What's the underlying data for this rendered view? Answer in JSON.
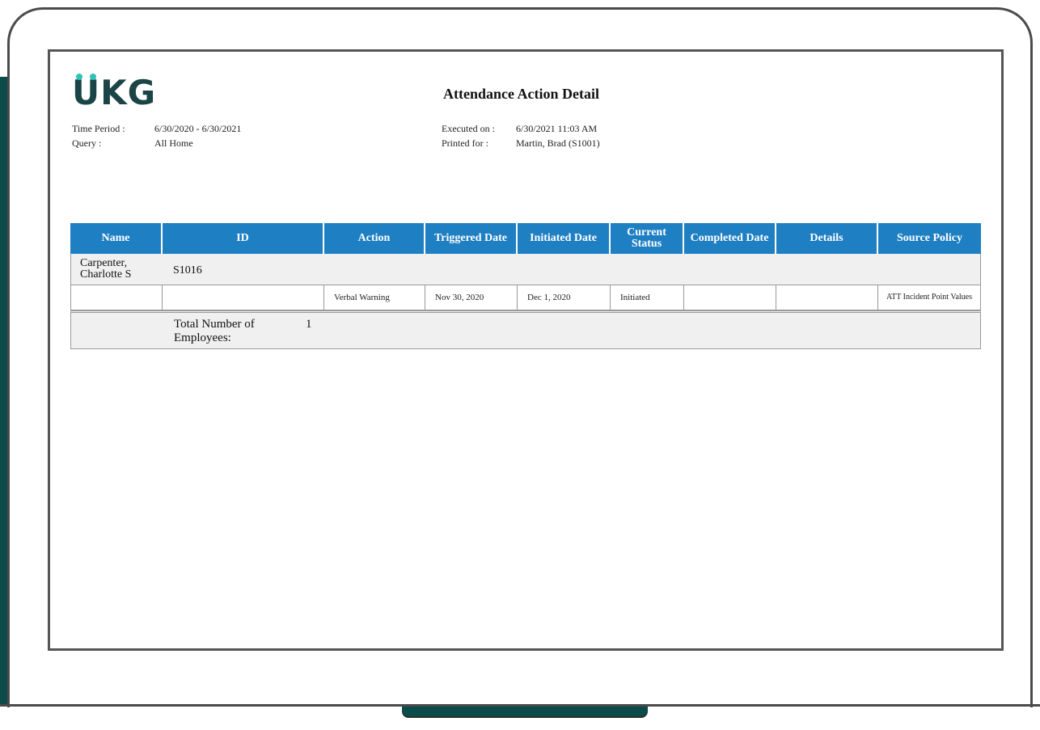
{
  "report": {
    "logo_text": "UKG",
    "title": "Attendance Action Detail",
    "time_period_label": "Time Period :",
    "time_period_value": "6/30/2020 - 6/30/2021",
    "query_label": "Query :",
    "query_value": "All Home",
    "executed_label": "Executed on :",
    "executed_value": "6/30/2021 11:03 AM",
    "printed_label": "Printed for :",
    "printed_value": "Martin, Brad (S1001)"
  },
  "table": {
    "columns": [
      "Name",
      "ID",
      "Action",
      "Triggered Date",
      "Initiated Date",
      "Current Status",
      "Completed Date",
      "Details",
      "Source Policy"
    ],
    "employee": {
      "name": "Carpenter, Charlotte S",
      "id": "S1016"
    },
    "action_row": {
      "name": "",
      "id": "",
      "action": "Verbal Warning",
      "triggered_date": "Nov 30, 2020",
      "initiated_date": "Dec 1, 2020",
      "current_status": "Initiated",
      "completed_date": "",
      "details": "",
      "source_policy": "ATT Incident Point Values"
    },
    "total_label": "Total Number of Employees:",
    "total_value": "1"
  },
  "colors": {
    "header_blue": "#1f7fc3",
    "frame_teal": "#0b4b4a",
    "logo_teal": "#1a4445",
    "logo_dots": "#2ec4b6"
  }
}
